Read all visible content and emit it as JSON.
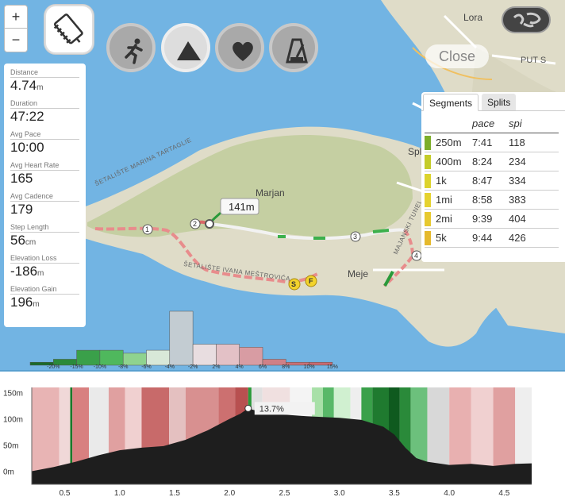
{
  "map": {
    "labels": {
      "lora": "Lora",
      "puts": "PUT S",
      "marjan": "Marjan",
      "meje": "Meje",
      "spl": "Spl",
      "split": "plit",
      "marina": "ŠETALIŠTE MARINA TARTAGLIE",
      "mestrovica": "ŠETALIŠTE IVANA MEŠTROVIĆA",
      "tunel": "MAJANSKI TUNEL"
    },
    "markers": [
      "1",
      "2",
      "3",
      "4"
    ],
    "start_label": "S",
    "finish_label": "F",
    "callout": "141m"
  },
  "zoom": {
    "in": "+",
    "out": "−"
  },
  "icons": {
    "notebook": "notebook-pencil-icon",
    "modes": [
      "runner-icon",
      "mountain-icon",
      "heart-icon",
      "metronome-icon"
    ],
    "globe": "globe-icon"
  },
  "close_label": "Close",
  "stats": [
    {
      "label": "Distance",
      "value": "4.74",
      "unit": "m"
    },
    {
      "label": "Duration",
      "value": "47:22",
      "unit": ""
    },
    {
      "label": "Avg Pace",
      "value": "10:00",
      "unit": ""
    },
    {
      "label": "Avg Heart Rate",
      "value": "165",
      "unit": ""
    },
    {
      "label": "Avg Cadence",
      "value": "179",
      "unit": ""
    },
    {
      "label": "Step Length",
      "value": "56",
      "unit": "cm"
    },
    {
      "label": "Elevation Loss",
      "value": "-186",
      "unit": "m"
    },
    {
      "label": "Elevation Gain",
      "value": "196",
      "unit": "m"
    }
  ],
  "segments": {
    "tabs": [
      "Segments",
      "Splits"
    ],
    "headers": [
      "pace",
      "spi"
    ],
    "rows": [
      {
        "name": "250m",
        "pace": "7:41",
        "spi": "118",
        "color": "#7dae2a"
      },
      {
        "name": "400m",
        "pace": "8:24",
        "spi": "234",
        "color": "#c4cc2a"
      },
      {
        "name": "1k",
        "pace": "8:47",
        "spi": "334",
        "color": "#dcd32c"
      },
      {
        "name": "1mi",
        "pace": "8:58",
        "spi": "383",
        "color": "#e5d22f"
      },
      {
        "name": "2mi",
        "pace": "9:39",
        "spi": "404",
        "color": "#e7c92f"
      },
      {
        "name": "5k",
        "pace": "9:44",
        "spi": "426",
        "color": "#e5b92c"
      }
    ]
  },
  "chart_data": [
    {
      "type": "bar",
      "title": "",
      "categories": [
        "-20%",
        "-15%",
        "-10%",
        "-8%",
        "-6%",
        "-4%",
        "-2%",
        "2%",
        "4%",
        "6%",
        "8%",
        "10%",
        "15%"
      ],
      "values": [
        1,
        2,
        5,
        5,
        4,
        5,
        18,
        7,
        7,
        6,
        2,
        1,
        1
      ],
      "colors": [
        "#1a6b2a",
        "#2a8a3a",
        "#3aa04a",
        "#4fb85d",
        "#8fd38f",
        "#d8e8d8",
        "#c3ccd2",
        "#e8dde0",
        "#e3c1c6",
        "#d89ca3",
        "#cf8087",
        "#c97077",
        "#c96a72"
      ]
    },
    {
      "type": "area",
      "title": "",
      "xlabel": "",
      "ylabel": "",
      "x_ticks": [
        "0.5",
        "1.0",
        "1.5",
        "2.0",
        "2.5",
        "3.0",
        "3.5",
        "4.0",
        "4.5"
      ],
      "y_ticks": [
        "150m",
        "100m",
        "50m",
        "0m"
      ],
      "ylim": [
        -25,
        160
      ],
      "xlim": [
        0.2,
        4.75
      ],
      "annotation": "13.7%",
      "annotation_x": 2.17,
      "x": [
        0.2,
        0.4,
        0.6,
        0.8,
        1.0,
        1.2,
        1.4,
        1.6,
        1.8,
        2.0,
        2.1,
        2.17,
        2.3,
        2.5,
        2.7,
        3.0,
        3.2,
        3.4,
        3.5,
        3.6,
        3.7,
        3.8,
        4.0,
        4.2,
        4.4,
        4.6,
        4.75
      ],
      "y": [
        0,
        8,
        18,
        30,
        40,
        45,
        48,
        60,
        78,
        100,
        110,
        120,
        112,
        108,
        105,
        102,
        98,
        85,
        70,
        45,
        25,
        18,
        12,
        14,
        10,
        14,
        15
      ]
    }
  ]
}
